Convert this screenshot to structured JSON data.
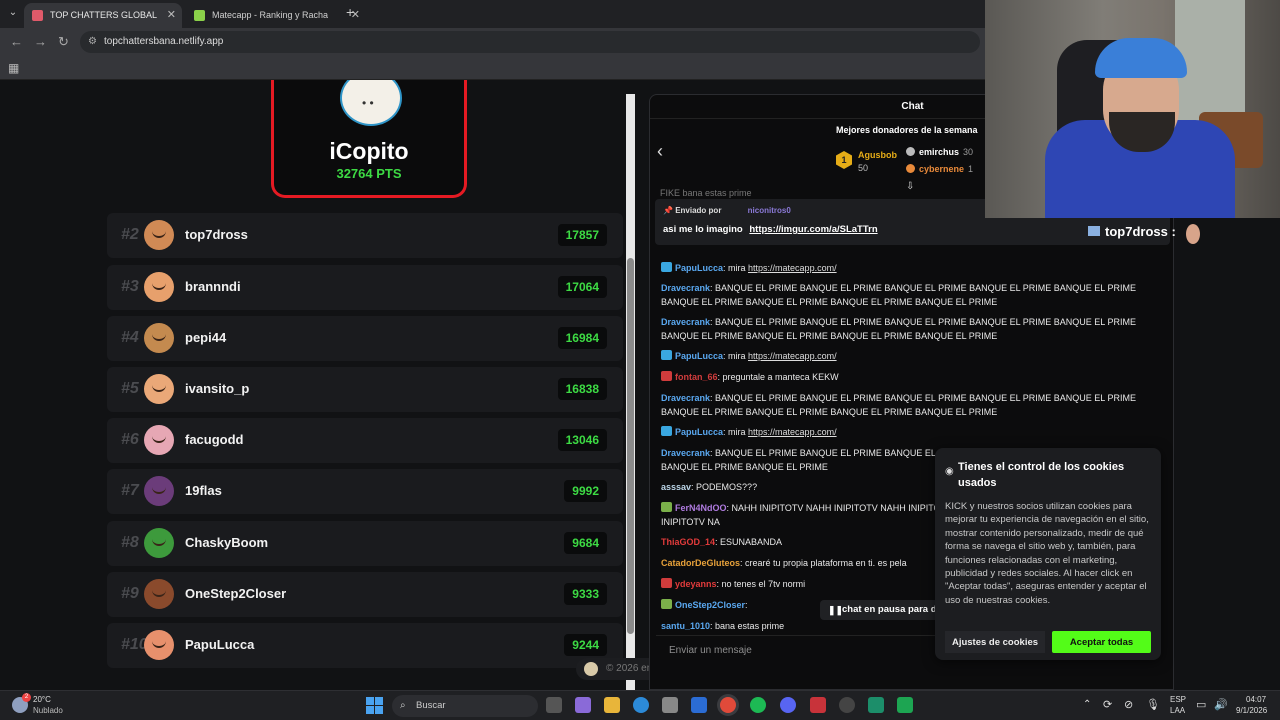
{
  "browser": {
    "tabs": [
      {
        "title": "TOP CHATTERS GLOBAL",
        "favicon_color": "#e05a6a"
      },
      {
        "title": "Matecapp - Ranking y Racha de",
        "favicon_color": "#8bd14a"
      }
    ],
    "url": "topchattersbana.netlify.app"
  },
  "leaderboard": {
    "top": {
      "name": "iCopito",
      "points": "32764 PTS"
    },
    "rows": [
      {
        "rank": "#2",
        "user": "top7dross",
        "score": "17857",
        "avatar_color": "#d18a55"
      },
      {
        "rank": "#3",
        "user": "brannndi",
        "score": "17064",
        "avatar_color": "#e7a06c"
      },
      {
        "rank": "#4",
        "user": "pepi44",
        "score": "16984",
        "avatar_color": "#c48a4f"
      },
      {
        "rank": "#5",
        "user": "ivansito_p",
        "score": "16838",
        "avatar_color": "#eaa878"
      },
      {
        "rank": "#6",
        "user": "facugodd",
        "score": "13046",
        "avatar_color": "#e6a7b4"
      },
      {
        "rank": "#7",
        "user": "19flas",
        "score": "9992",
        "avatar_color": "#6b3c7a"
      },
      {
        "rank": "#8",
        "user": "ChaskyBoom",
        "score": "9684",
        "avatar_color": "#3d9a3c"
      },
      {
        "rank": "#9",
        "user": "OneStep2Closer",
        "score": "9333",
        "avatar_color": "#8a4a2c"
      },
      {
        "rank": "#10",
        "user": "PapuLucca",
        "score": "9244",
        "avatar_color": "#e7906c"
      }
    ],
    "footer": "© 2026 emaidana09"
  },
  "chat": {
    "title": "Chat",
    "donors_title": "Mejores donadores de la semana",
    "donor1": {
      "rank": "1",
      "name": "Agusbob",
      "amount": "50"
    },
    "donor2": {
      "name": "emirchus",
      "amount": "30"
    },
    "donor3": {
      "name": "cybernene",
      "amount": "1"
    },
    "cut_line": "FIKE bana estas prime",
    "pinned": {
      "sent_by": "Enviado por",
      "user": "niconitros0",
      "text": "asi me lo imagino",
      "link": "https://imgur.com/a/SLaTTrn"
    },
    "messages": [
      {
        "user": "PapuLucca",
        "color": "#5aa8f0",
        "text": ": mira ",
        "link": "https://matecapp.com/",
        "badge": "#3aa7e0"
      },
      {
        "user": "Dravecrank",
        "color": "#5aa8f0",
        "text": ": BANQUE EL PRIME BANQUE EL PRIME BANQUE EL PRIME BANQUE EL PRIME BANQUE EL PRIME BANQUE EL PRIME BANQUE EL PRIME BANQUE EL PRIME BANQUE EL PRIME"
      },
      {
        "user": "Dravecrank",
        "color": "#5aa8f0",
        "text": ": BANQUE EL PRIME BANQUE EL PRIME BANQUE EL PRIME BANQUE EL PRIME BANQUE EL PRIME BANQUE EL PRIME BANQUE EL PRIME BANQUE EL PRIME BANQUE EL PRIME"
      },
      {
        "user": "PapuLucca",
        "color": "#5aa8f0",
        "text": ": mira ",
        "link": "https://matecapp.com/",
        "badge": "#3aa7e0"
      },
      {
        "user": "fontan_66",
        "color": "#d03c3c",
        "text": ": preguntale a manteca KEKW",
        "badge": "#d03c3c"
      },
      {
        "user": "Dravecrank",
        "color": "#5aa8f0",
        "text": ": BANQUE EL PRIME BANQUE EL PRIME BANQUE EL PRIME BANQUE EL PRIME BANQUE EL PRIME BANQUE EL PRIME BANQUE EL PRIME BANQUE EL PRIME BANQUE EL PRIME"
      },
      {
        "user": "PapuLucca",
        "color": "#5aa8f0",
        "text": ": mira ",
        "link": "https://matecapp.com/",
        "badge": "#3aa7e0"
      },
      {
        "user": "Dravecrank",
        "color": "#5aa8f0",
        "text": ": BANQUE EL PRIME BANQUE EL PRIME BANQUE EL PRIME BANQUE EL PRIME BANQUE EL PRIME BANQUE EL PRIME BANQUE EL PRIME"
      },
      {
        "user": "asssav",
        "color": "#bcd6e8",
        "text": ": PODEMOS???"
      },
      {
        "user": "FerN4NdOO",
        "color": "#b07be0",
        "text": ": NAHH INIPITOTV NAHH INIPITOTV NAHH INIPITOTV NAHH INIPITOTV NAHH INIPITOTV NAHH INIPITOTV NA",
        "badge": "#7bb04a"
      },
      {
        "user": "ThiaGOD_14",
        "color": "#e23b3b",
        "text": ": ESUNABANDA"
      },
      {
        "user": "CatadorDeGluteos",
        "color": "#e8a23a",
        "text": ": crearé tu propia plataforma en ti. es pela"
      },
      {
        "user": "ydeyanns",
        "color": "#e23b3b",
        "text": ": no tenes el 7tv normi",
        "badge": "#d03c3c"
      },
      {
        "user": "OneStep2Closer",
        "color": "#5aa8f0",
        "text": ":",
        "badge": "#7bb04a"
      },
      {
        "user": "santu_1010",
        "color": "#5aa8f0",
        "text": ": bana estas prime"
      }
    ],
    "paused": "chat en pausa para de",
    "input_placeholder": "Enviar un mensaje"
  },
  "cookies": {
    "title": "Tienes el control de los cookies usados",
    "body": "KICK y nuestros socios utilizan cookies para mejorar tu experiencia de navegación en el sitio, mostrar contenido personalizado, medir de qué forma se navega el sitio web y, también, para funciones relacionadas con el marketing, publicidad y redes sociales. Al hacer click en \"Aceptar todas\", aseguras entender y aceptar el uso de nuestras cookies.",
    "settings": "Ajustes de cookies",
    "accept": "Aceptar todas"
  },
  "overlay": {
    "name": "top7dross",
    "suffix": ":"
  },
  "taskbar": {
    "weather_temp": "20°C",
    "weather_desc": "Nublado",
    "weather_badge": "2",
    "search": "Buscar",
    "lang": "ESP",
    "region": "LAA",
    "time": "04:07",
    "date": "9/1/2026"
  }
}
